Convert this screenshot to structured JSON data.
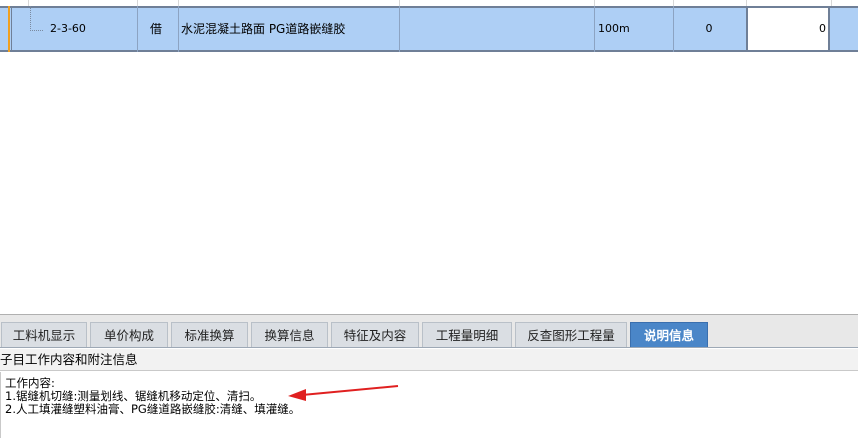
{
  "grid": {
    "selected_row": {
      "code": "2-3-60",
      "type": "借",
      "name": "水泥混凝土路面 PG道路嵌缝胶",
      "unit": "100m",
      "quantity_expr": "0",
      "quantity": "0"
    }
  },
  "tabs": [
    {
      "label": "工料机显示",
      "active": false
    },
    {
      "label": "单价构成",
      "active": false
    },
    {
      "label": "标准换算",
      "active": false
    },
    {
      "label": "换算信息",
      "active": false
    },
    {
      "label": "特征及内容",
      "active": false
    },
    {
      "label": "工程量明细",
      "active": false
    },
    {
      "label": "反查图形工程量",
      "active": false
    },
    {
      "label": "说明信息",
      "active": true
    }
  ],
  "panel": {
    "subtitle": "子目工作内容和附注信息",
    "content_heading": "工作内容:",
    "content_lines": [
      "1.锯缝机切缝:测量划线、锯缝机移动定位、清扫。",
      "2.人工填灌缝塑料油膏、PG缝道路嵌缝胶:清缝、填灌缝。"
    ]
  },
  "colors": {
    "row_selected": "#aecff5",
    "tab_active": "#4a86c8",
    "annotation_arrow": "#e02020"
  }
}
